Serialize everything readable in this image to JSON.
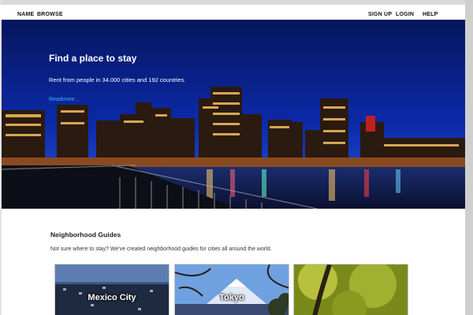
{
  "nav": {
    "left": [
      "NAME",
      "BROWSE"
    ],
    "right": [
      "SIGN UP",
      "LOGIN",
      "HELP"
    ]
  },
  "hero": {
    "title": "Find a place to stay",
    "subtitle": "Rent from people in 34.000 cities and 192 countries.",
    "link": "Readmore..."
  },
  "guides": {
    "title": "Neighborhood Guides",
    "subtitle": "Not sure where to stay? We've created neighborhood guides for cities all around the world.",
    "cards": [
      {
        "label": "Mexico City"
      },
      {
        "label": "Tokyo"
      },
      {
        "label": ""
      }
    ]
  },
  "colors": {
    "link": "#3ab6ff",
    "sky": "#071a66"
  }
}
